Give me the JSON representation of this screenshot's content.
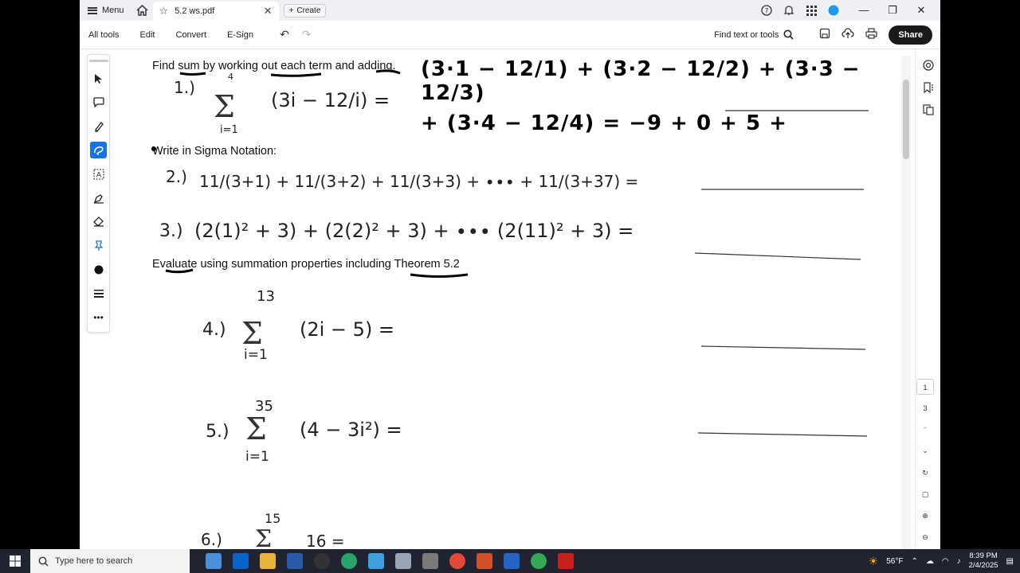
{
  "titlebar": {
    "menu_label": "Menu",
    "tab_title": "5.2 ws.pdf",
    "create_label": "Create"
  },
  "toolbar": {
    "items": [
      "All tools",
      "Edit",
      "Convert",
      "E-Sign"
    ],
    "find_label": "Find text or tools",
    "share_label": "Share"
  },
  "document": {
    "heading1": "Find sum by working out each term and adding.",
    "heading2": "Write in Sigma Notation:",
    "heading3": "Evaluate using summation properties including Theorem 5.2",
    "problem1": "1.)",
    "problem1_expr": "(3i − 12/i) =",
    "problem1_upper": "4",
    "problem1_lower": "i=1",
    "problem1_work_line1": "(3·1 − 12/1) + (3·2 − 12/2) + (3·3 − 12/3)",
    "problem1_work_line2": "+ (3·4 − 12/4) = −9 + 0 + 5 +",
    "problem2": "2.)",
    "problem2_expr": "11/(3+1) + 11/(3+2) + 11/(3+3) + ∙∙∙ + 11/(3+37) =",
    "problem3": "3.)",
    "problem3_expr": "(2(1)² + 3) + (2(2)² + 3) + ∙∙∙ (2(11)² + 3) =",
    "problem4": "4.)",
    "problem4_upper": "13",
    "problem4_lower": "i=1",
    "problem4_expr": "(2i − 5) =",
    "problem5": "5.)",
    "problem5_upper": "35",
    "problem5_lower": "i=1",
    "problem5_expr": "(4 − 3i²) =",
    "problem6": "6.)",
    "problem6_upper": "15",
    "problem6_expr": "16 ="
  },
  "pages": {
    "current": "1",
    "total": "3"
  },
  "taskbar": {
    "search_placeholder": "Type here to search",
    "weather": "56°F",
    "time": "8:39 PM",
    "date": "2/4/2025"
  },
  "colors": {
    "accent": "#1473e6",
    "share_bg": "#1a1a1a",
    "taskbar_bg": "#1f2430"
  }
}
